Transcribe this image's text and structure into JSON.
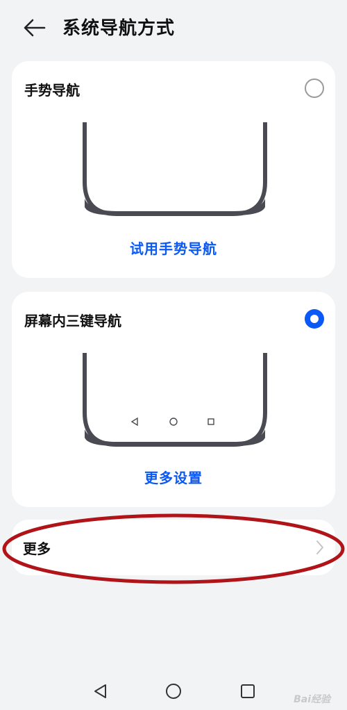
{
  "header": {
    "title": "系统导航方式",
    "back_icon": "arrow-left-icon"
  },
  "options": [
    {
      "title": "手势导航",
      "selected": false,
      "action_label": "试用手势导航"
    },
    {
      "title": "屏幕内三键导航",
      "selected": true,
      "action_label": "更多设置"
    }
  ],
  "more": {
    "label": "更多",
    "icon": "chevron-right-icon"
  },
  "navbar": {
    "icons": [
      "triangle-back-icon",
      "circle-home-icon",
      "square-recent-icon"
    ]
  },
  "watermark": {
    "text": "Bai经验"
  },
  "colors": {
    "accent": "#0a59f7",
    "background": "#f1f3f5",
    "card": "#ffffff",
    "annotation": "#b01418"
  }
}
